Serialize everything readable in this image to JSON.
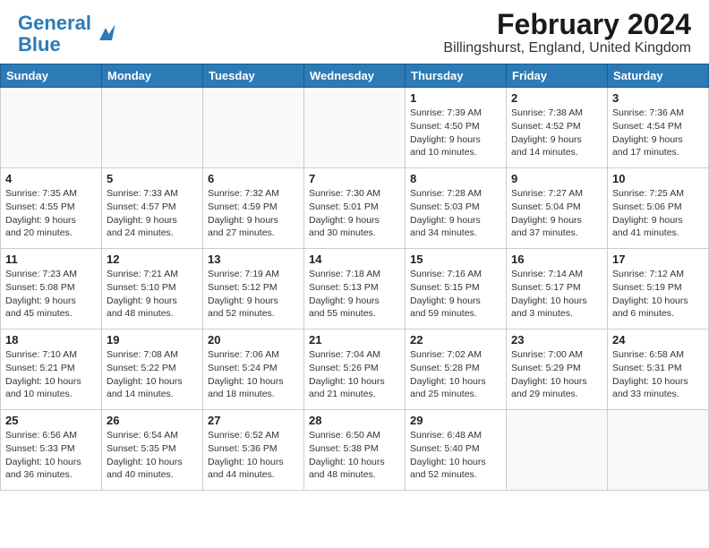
{
  "header": {
    "logo_line1": "General",
    "logo_line2": "Blue",
    "month_year": "February 2024",
    "location": "Billingshurst, England, United Kingdom"
  },
  "weekdays": [
    "Sunday",
    "Monday",
    "Tuesday",
    "Wednesday",
    "Thursday",
    "Friday",
    "Saturday"
  ],
  "weeks": [
    [
      {
        "day": "",
        "info": ""
      },
      {
        "day": "",
        "info": ""
      },
      {
        "day": "",
        "info": ""
      },
      {
        "day": "",
        "info": ""
      },
      {
        "day": "1",
        "info": "Sunrise: 7:39 AM\nSunset: 4:50 PM\nDaylight: 9 hours\nand 10 minutes."
      },
      {
        "day": "2",
        "info": "Sunrise: 7:38 AM\nSunset: 4:52 PM\nDaylight: 9 hours\nand 14 minutes."
      },
      {
        "day": "3",
        "info": "Sunrise: 7:36 AM\nSunset: 4:54 PM\nDaylight: 9 hours\nand 17 minutes."
      }
    ],
    [
      {
        "day": "4",
        "info": "Sunrise: 7:35 AM\nSunset: 4:55 PM\nDaylight: 9 hours\nand 20 minutes."
      },
      {
        "day": "5",
        "info": "Sunrise: 7:33 AM\nSunset: 4:57 PM\nDaylight: 9 hours\nand 24 minutes."
      },
      {
        "day": "6",
        "info": "Sunrise: 7:32 AM\nSunset: 4:59 PM\nDaylight: 9 hours\nand 27 minutes."
      },
      {
        "day": "7",
        "info": "Sunrise: 7:30 AM\nSunset: 5:01 PM\nDaylight: 9 hours\nand 30 minutes."
      },
      {
        "day": "8",
        "info": "Sunrise: 7:28 AM\nSunset: 5:03 PM\nDaylight: 9 hours\nand 34 minutes."
      },
      {
        "day": "9",
        "info": "Sunrise: 7:27 AM\nSunset: 5:04 PM\nDaylight: 9 hours\nand 37 minutes."
      },
      {
        "day": "10",
        "info": "Sunrise: 7:25 AM\nSunset: 5:06 PM\nDaylight: 9 hours\nand 41 minutes."
      }
    ],
    [
      {
        "day": "11",
        "info": "Sunrise: 7:23 AM\nSunset: 5:08 PM\nDaylight: 9 hours\nand 45 minutes."
      },
      {
        "day": "12",
        "info": "Sunrise: 7:21 AM\nSunset: 5:10 PM\nDaylight: 9 hours\nand 48 minutes."
      },
      {
        "day": "13",
        "info": "Sunrise: 7:19 AM\nSunset: 5:12 PM\nDaylight: 9 hours\nand 52 minutes."
      },
      {
        "day": "14",
        "info": "Sunrise: 7:18 AM\nSunset: 5:13 PM\nDaylight: 9 hours\nand 55 minutes."
      },
      {
        "day": "15",
        "info": "Sunrise: 7:16 AM\nSunset: 5:15 PM\nDaylight: 9 hours\nand 59 minutes."
      },
      {
        "day": "16",
        "info": "Sunrise: 7:14 AM\nSunset: 5:17 PM\nDaylight: 10 hours\nand 3 minutes."
      },
      {
        "day": "17",
        "info": "Sunrise: 7:12 AM\nSunset: 5:19 PM\nDaylight: 10 hours\nand 6 minutes."
      }
    ],
    [
      {
        "day": "18",
        "info": "Sunrise: 7:10 AM\nSunset: 5:21 PM\nDaylight: 10 hours\nand 10 minutes."
      },
      {
        "day": "19",
        "info": "Sunrise: 7:08 AM\nSunset: 5:22 PM\nDaylight: 10 hours\nand 14 minutes."
      },
      {
        "day": "20",
        "info": "Sunrise: 7:06 AM\nSunset: 5:24 PM\nDaylight: 10 hours\nand 18 minutes."
      },
      {
        "day": "21",
        "info": "Sunrise: 7:04 AM\nSunset: 5:26 PM\nDaylight: 10 hours\nand 21 minutes."
      },
      {
        "day": "22",
        "info": "Sunrise: 7:02 AM\nSunset: 5:28 PM\nDaylight: 10 hours\nand 25 minutes."
      },
      {
        "day": "23",
        "info": "Sunrise: 7:00 AM\nSunset: 5:29 PM\nDaylight: 10 hours\nand 29 minutes."
      },
      {
        "day": "24",
        "info": "Sunrise: 6:58 AM\nSunset: 5:31 PM\nDaylight: 10 hours\nand 33 minutes."
      }
    ],
    [
      {
        "day": "25",
        "info": "Sunrise: 6:56 AM\nSunset: 5:33 PM\nDaylight: 10 hours\nand 36 minutes."
      },
      {
        "day": "26",
        "info": "Sunrise: 6:54 AM\nSunset: 5:35 PM\nDaylight: 10 hours\nand 40 minutes."
      },
      {
        "day": "27",
        "info": "Sunrise: 6:52 AM\nSunset: 5:36 PM\nDaylight: 10 hours\nand 44 minutes."
      },
      {
        "day": "28",
        "info": "Sunrise: 6:50 AM\nSunset: 5:38 PM\nDaylight: 10 hours\nand 48 minutes."
      },
      {
        "day": "29",
        "info": "Sunrise: 6:48 AM\nSunset: 5:40 PM\nDaylight: 10 hours\nand 52 minutes."
      },
      {
        "day": "",
        "info": ""
      },
      {
        "day": "",
        "info": ""
      }
    ]
  ]
}
